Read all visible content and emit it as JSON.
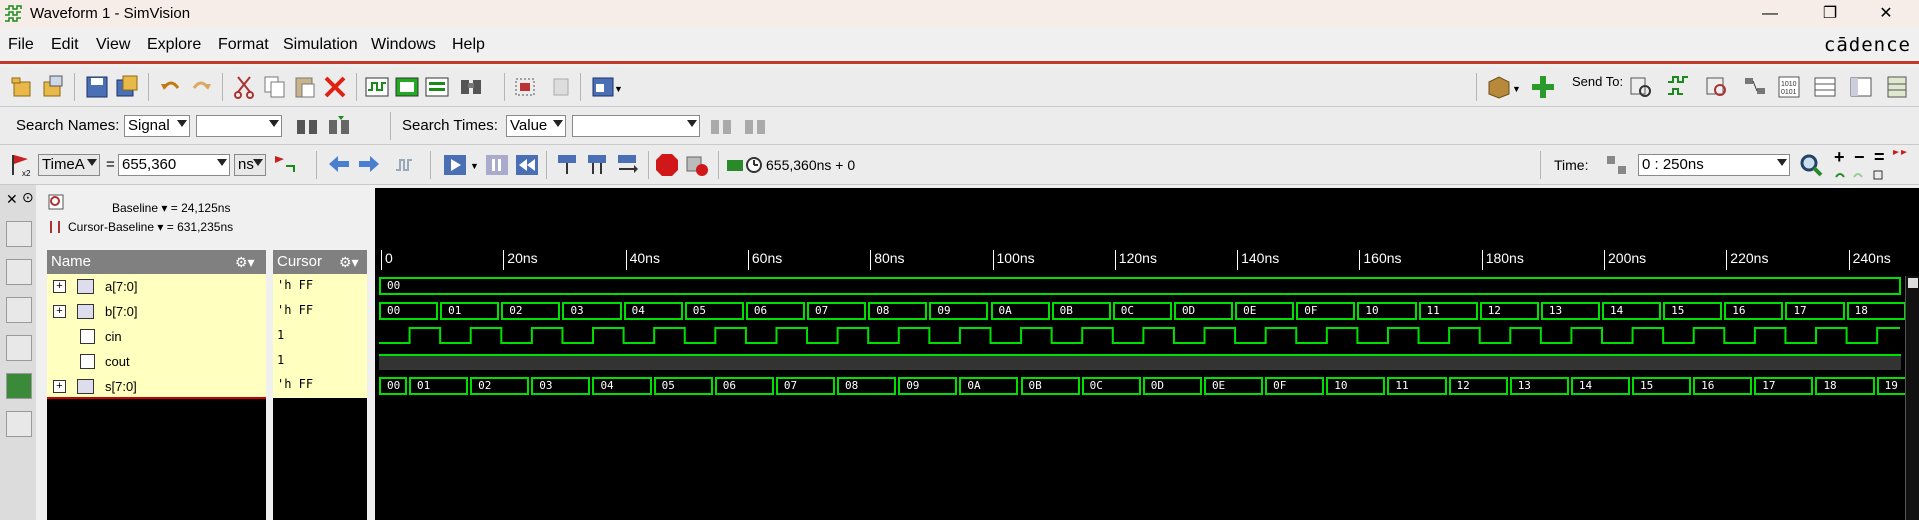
{
  "window": {
    "title": "Waveform 1 - SimVision",
    "logo": "cādence"
  },
  "menu": [
    "File",
    "Edit",
    "View",
    "Explore",
    "Format",
    "Simulation",
    "Windows",
    "Help"
  ],
  "search": {
    "names_label": "Search Names:",
    "names_type": "Signal",
    "times_label": "Search Times:",
    "times_type": "Value",
    "send_to_label": "Send To:"
  },
  "time": {
    "marker": "TimeA",
    "equals": "=",
    "value": "655,360",
    "unit": "ns",
    "sim_time": "655,360ns + 0",
    "range_label": "Time:",
    "range_value": "0 : 250ns"
  },
  "cursor_info": {
    "baseline": "Baseline ▾ = 24,125ns",
    "cursor_baseline": "Cursor-Baseline ▾ = 631,235ns"
  },
  "columns": {
    "name": "Name",
    "cursor": "Cursor"
  },
  "signals": [
    {
      "name": "a[7:0]",
      "cursor": "'h FF",
      "kind": "bus"
    },
    {
      "name": "b[7:0]",
      "cursor": "'h FF",
      "kind": "bus"
    },
    {
      "name": "cin",
      "cursor": "1",
      "kind": "bit"
    },
    {
      "name": "cout",
      "cursor": "1",
      "kind": "bit"
    },
    {
      "name": "s[7:0]",
      "cursor": "'h FF",
      "kind": "bus"
    }
  ],
  "ruler_ticks": [
    "0",
    "20ns",
    "40ns",
    "60ns",
    "80ns",
    "100ns",
    "120ns",
    "140ns",
    "160ns",
    "180ns",
    "200ns",
    "220ns",
    "240ns"
  ],
  "waveforms": {
    "a": [
      "00"
    ],
    "b": [
      "00",
      "01",
      "02",
      "03",
      "04",
      "05",
      "06",
      "07",
      "08",
      "09",
      "0A",
      "0B",
      "0C",
      "0D",
      "0E",
      "0F",
      "10",
      "11",
      "12",
      "13",
      "14",
      "15",
      "16",
      "17",
      "18"
    ],
    "s": [
      "00",
      "01",
      "02",
      "03",
      "04",
      "05",
      "06",
      "07",
      "08",
      "09",
      "0A",
      "0B",
      "0C",
      "0D",
      "0E",
      "0F",
      "10",
      "11",
      "12",
      "13",
      "14",
      "15",
      "16",
      "17",
      "18",
      "19"
    ]
  },
  "colors": {
    "wave": "#00e000",
    "accent": "#c0392b",
    "name_panel": "#ffffc0"
  }
}
